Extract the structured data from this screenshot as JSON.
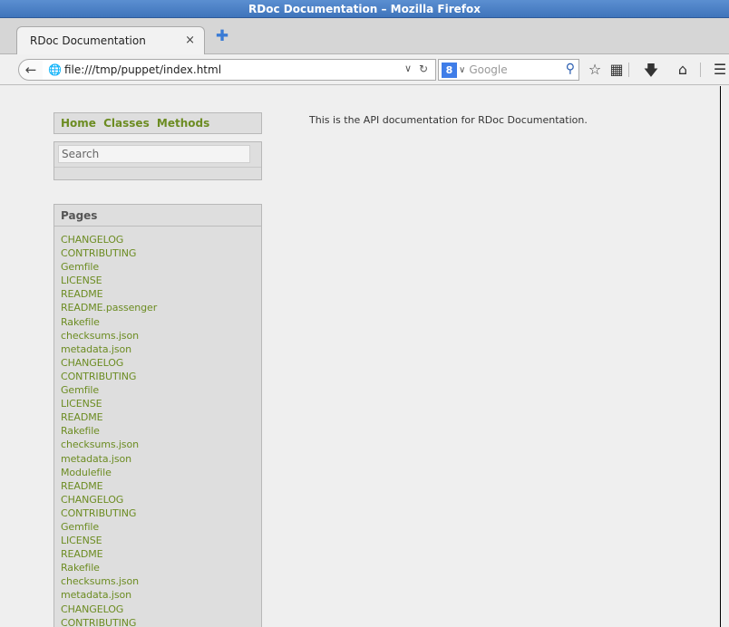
{
  "window": {
    "title": "RDoc Documentation – Mozilla Firefox"
  },
  "tab": {
    "title": "RDoc Documentation",
    "close_glyph": "×",
    "new_tab_glyph": "✚"
  },
  "toolbar": {
    "back_glyph": "🡄",
    "url": "file:///tmp/puppet/index.html",
    "search_placeholder": "Google",
    "icons": [
      "bookmark-star-icon",
      "reading-list-icon",
      "download-icon",
      "home-icon",
      "menu-icon"
    ]
  },
  "sidebar": {
    "nav": [
      "Home",
      "Classes",
      "Methods"
    ],
    "search_placeholder": "Search",
    "pages_title": "Pages",
    "pages": [
      "CHANGELOG",
      "CONTRIBUTING",
      "Gemfile",
      "LICENSE",
      "README",
      "README.passenger",
      "Rakefile",
      "checksums.json",
      "metadata.json",
      "CHANGELOG",
      "CONTRIBUTING",
      "Gemfile",
      "LICENSE",
      "README",
      "Rakefile",
      "checksums.json",
      "metadata.json",
      "Modulefile",
      "README",
      "CHANGELOG",
      "CONTRIBUTING",
      "Gemfile",
      "LICENSE",
      "README",
      "Rakefile",
      "checksums.json",
      "metadata.json",
      "CHANGELOG",
      "CONTRIBUTING"
    ]
  },
  "main": {
    "intro": "This is the API documentation for RDoc Documentation."
  },
  "colors": {
    "link": "#6c8c22",
    "titlebar": "#4a80c6"
  }
}
